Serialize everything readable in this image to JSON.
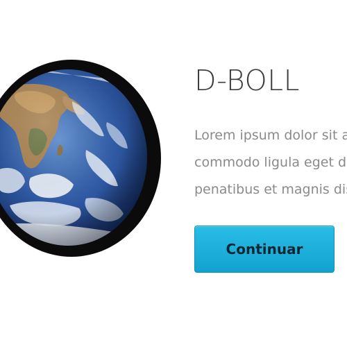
{
  "product": {
    "title": "D-BOLL",
    "description_lines": [
      "Lorem ipsum dolor sit a",
      "commodo ligula eget do",
      "penatibus et magnis dis"
    ]
  },
  "actions": {
    "continue_label": "Continuar"
  },
  "image": {
    "icon": "earth-globe-image"
  },
  "colors": {
    "button": "#1fb0dc",
    "title": "#3d3d3d",
    "body_text": "#8a8a8a",
    "globe_border": "#0b0b0b"
  }
}
